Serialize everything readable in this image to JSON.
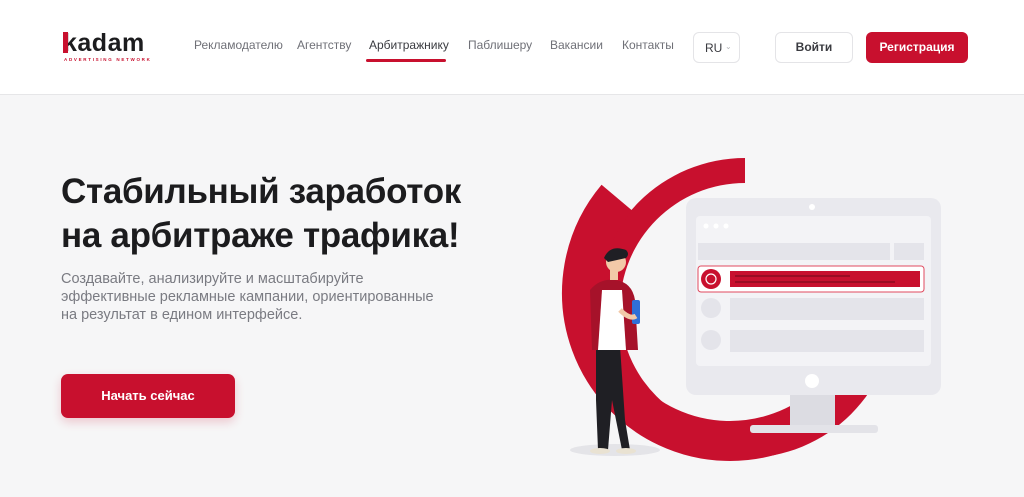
{
  "brand": {
    "logo_text": "kadam",
    "logo_tagline": "ADVERTISING NETWORK",
    "accent_color": "#c8102e"
  },
  "nav": {
    "items": [
      {
        "label": "Рекламодателю"
      },
      {
        "label": "Агентству"
      },
      {
        "label": "Арбитражнику"
      },
      {
        "label": "Паблишеру"
      },
      {
        "label": "Вакансии"
      },
      {
        "label": "Контакты"
      }
    ],
    "active": "Арбитражнику"
  },
  "language": {
    "selected": "RU"
  },
  "auth": {
    "login_label": "Войти",
    "register_label": "Регистрация"
  },
  "hero": {
    "title_line1": "Стабильный заработок",
    "title_line2": "на арбитраже трафика!",
    "subtitle_line1": "Создавайте, анализируйте и масштабируйте",
    "subtitle_line2": "эффективные рекламные кампании, ориентированные",
    "subtitle_line3": "на результат в едином интерфейсе.",
    "cta_label": "Начать сейчас"
  }
}
